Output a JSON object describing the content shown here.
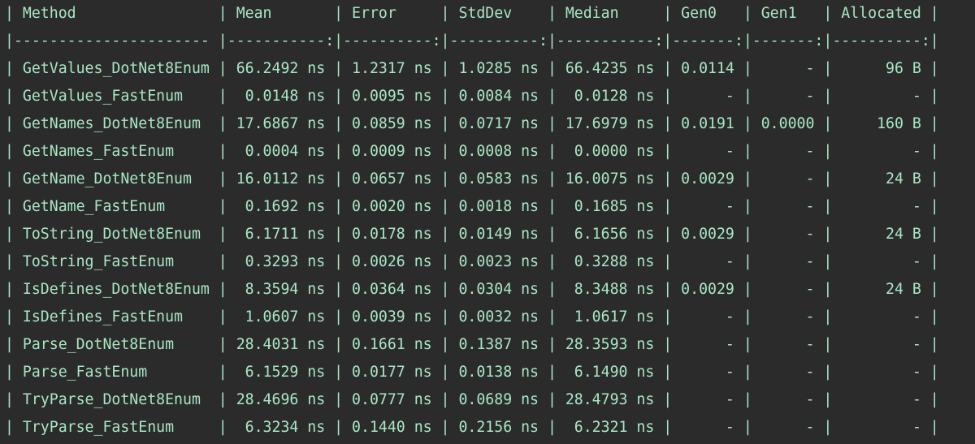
{
  "table": {
    "header": "| Method                | Mean       | Error     | StdDev    | Median     | Gen0   | Gen1   | Allocated |",
    "separator": "|---------------------- |-----------:|----------:|----------:|-----------:|-------:|-------:|----------:|",
    "columns": [
      "Method",
      "Mean",
      "Error",
      "StdDev",
      "Median",
      "Gen0",
      "Gen1",
      "Allocated"
    ],
    "rows": [
      {
        "line": "| GetValues_DotNet8Enum | 66.2492 ns | 1.2317 ns | 1.0285 ns | 66.4235 ns | 0.0114 |      - |      96 B |",
        "cells": [
          "GetValues_DotNet8Enum",
          "66.2492 ns",
          "1.2317 ns",
          "1.0285 ns",
          "66.4235 ns",
          "0.0114",
          "-",
          "96 B"
        ]
      },
      {
        "line": "| GetValues_FastEnum    |  0.0148 ns | 0.0095 ns | 0.0084 ns |  0.0128 ns |      - |      - |         - |",
        "cells": [
          "GetValues_FastEnum",
          "0.0148 ns",
          "0.0095 ns",
          "0.0084 ns",
          "0.0128 ns",
          "-",
          "-",
          "-"
        ]
      },
      {
        "line": "| GetNames_DotNet8Enum  | 17.6867 ns | 0.0859 ns | 0.0717 ns | 17.6979 ns | 0.0191 | 0.0000 |     160 B |",
        "cells": [
          "GetNames_DotNet8Enum",
          "17.6867 ns",
          "0.0859 ns",
          "0.0717 ns",
          "17.6979 ns",
          "0.0191",
          "0.0000",
          "160 B"
        ]
      },
      {
        "line": "| GetNames_FastEnum     |  0.0004 ns | 0.0009 ns | 0.0008 ns |  0.0000 ns |      - |      - |         - |",
        "cells": [
          "GetNames_FastEnum",
          "0.0004 ns",
          "0.0009 ns",
          "0.0008 ns",
          "0.0000 ns",
          "-",
          "-",
          "-"
        ]
      },
      {
        "line": "| GetName_DotNet8Enum   | 16.0112 ns | 0.0657 ns | 0.0583 ns | 16.0075 ns | 0.0029 |      - |      24 B |",
        "cells": [
          "GetName_DotNet8Enum",
          "16.0112 ns",
          "0.0657 ns",
          "0.0583 ns",
          "16.0075 ns",
          "0.0029",
          "-",
          "24 B"
        ]
      },
      {
        "line": "| GetName_FastEnum      |  0.1692 ns | 0.0020 ns | 0.0018 ns |  0.1685 ns |      - |      - |         - |",
        "cells": [
          "GetName_FastEnum",
          "0.1692 ns",
          "0.0020 ns",
          "0.0018 ns",
          "0.1685 ns",
          "-",
          "-",
          "-"
        ]
      },
      {
        "line": "| ToString_DotNet8Enum  |  6.1711 ns | 0.0178 ns | 0.0149 ns |  6.1656 ns | 0.0029 |      - |      24 B |",
        "cells": [
          "ToString_DotNet8Enum",
          "6.1711 ns",
          "0.0178 ns",
          "0.0149 ns",
          "6.1656 ns",
          "0.0029",
          "-",
          "24 B"
        ]
      },
      {
        "line": "| ToString_FastEnum     |  0.3293 ns | 0.0026 ns | 0.0023 ns |  0.3288 ns |      - |      - |         - |",
        "cells": [
          "ToString_FastEnum",
          "0.3293 ns",
          "0.0026 ns",
          "0.0023 ns",
          "0.3288 ns",
          "-",
          "-",
          "-"
        ]
      },
      {
        "line": "| IsDefines_DotNet8Enum |  8.3594 ns | 0.0364 ns | 0.0304 ns |  8.3488 ns | 0.0029 |      - |      24 B |",
        "cells": [
          "IsDefines_DotNet8Enum",
          "8.3594 ns",
          "0.0364 ns",
          "0.0304 ns",
          "8.3488 ns",
          "0.0029",
          "-",
          "24 B"
        ]
      },
      {
        "line": "| IsDefines_FastEnum    |  1.0607 ns | 0.0039 ns | 0.0032 ns |  1.0617 ns |      - |      - |         - |",
        "cells": [
          "IsDefines_FastEnum",
          "1.0607 ns",
          "0.0039 ns",
          "0.0032 ns",
          "1.0617 ns",
          "-",
          "-",
          "-"
        ]
      },
      {
        "line": "| Parse_DotNet8Enum     | 28.4031 ns | 0.1661 ns | 0.1387 ns | 28.3593 ns |      - |      - |         - |",
        "cells": [
          "Parse_DotNet8Enum",
          "28.4031 ns",
          "0.1661 ns",
          "0.1387 ns",
          "28.3593 ns",
          "-",
          "-",
          "-"
        ]
      },
      {
        "line": "| Parse_FastEnum        |  6.1529 ns | 0.0177 ns | 0.0138 ns |  6.1490 ns |      - |      - |         - |",
        "cells": [
          "Parse_FastEnum",
          "6.1529 ns",
          "0.0177 ns",
          "0.0138 ns",
          "6.1490 ns",
          "-",
          "-",
          "-"
        ]
      },
      {
        "line": "| TryParse_DotNet8Enum  | 28.4696 ns | 0.0777 ns | 0.0689 ns | 28.4793 ns |      - |      - |         - |",
        "cells": [
          "TryParse_DotNet8Enum",
          "28.4696 ns",
          "0.0777 ns",
          "0.0689 ns",
          "28.4793 ns",
          "-",
          "-",
          "-"
        ]
      },
      {
        "line": "| TryParse_FastEnum     |  6.3234 ns | 0.1440 ns | 0.2156 ns |  6.2321 ns |      - |      - |         - |",
        "cells": [
          "TryParse_FastEnum",
          "6.3234 ns",
          "0.1440 ns",
          "0.2156 ns",
          "6.2321 ns",
          "-",
          "-",
          "-"
        ]
      }
    ]
  },
  "colors": {
    "background": "#2b2b2b",
    "text": "#a8e6c4"
  }
}
